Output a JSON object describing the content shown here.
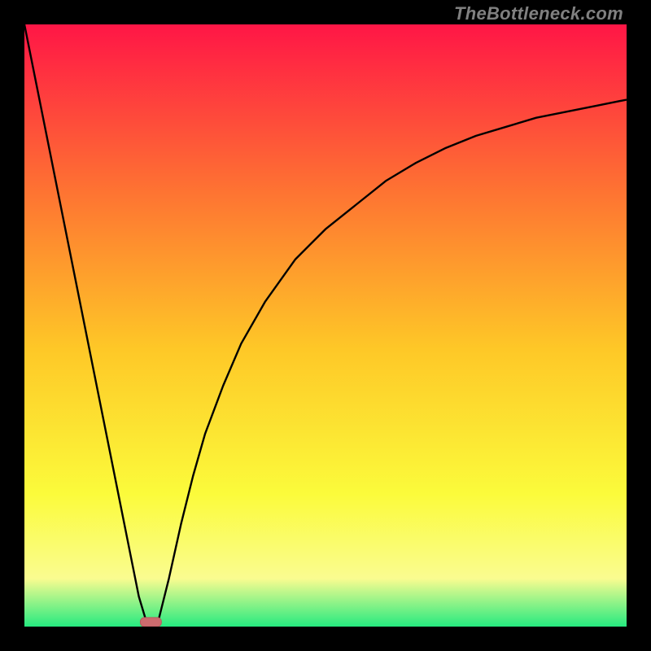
{
  "watermark": "TheBottleneck.com",
  "colors": {
    "frame": "#000000",
    "curve": "#000000",
    "marker_fill": "#CC6B6E",
    "marker_stroke": "#B85A5D",
    "gradient": {
      "top": "#FF1646",
      "q1": "#FE7432",
      "mid": "#FEC827",
      "q3": "#FBFB3B",
      "band": "#FAFC90",
      "bottom": "#26EA80"
    }
  },
  "chart_data": {
    "type": "line",
    "title": "",
    "xlabel": "",
    "ylabel": "",
    "xlim": [
      0,
      100
    ],
    "ylim": [
      0,
      100
    ],
    "series": [
      {
        "name": "left-segment",
        "x": [
          0,
          2,
          4,
          6,
          8,
          10,
          12,
          14,
          16,
          18,
          19,
          20.5
        ],
        "values": [
          100,
          90,
          80,
          70,
          60,
          50,
          40,
          30,
          20,
          10,
          5,
          0
        ]
      },
      {
        "name": "right-curve",
        "x": [
          22,
          24,
          26,
          28,
          30,
          33,
          36,
          40,
          45,
          50,
          55,
          60,
          65,
          70,
          75,
          80,
          85,
          90,
          95,
          100
        ],
        "values": [
          0,
          8,
          17,
          25,
          32,
          40,
          47,
          54,
          61,
          66,
          70,
          74,
          77,
          79.5,
          81.5,
          83,
          84.5,
          85.5,
          86.5,
          87.5
        ]
      }
    ],
    "marker": {
      "x": 21,
      "width": 3.5,
      "height": 1.5
    }
  }
}
